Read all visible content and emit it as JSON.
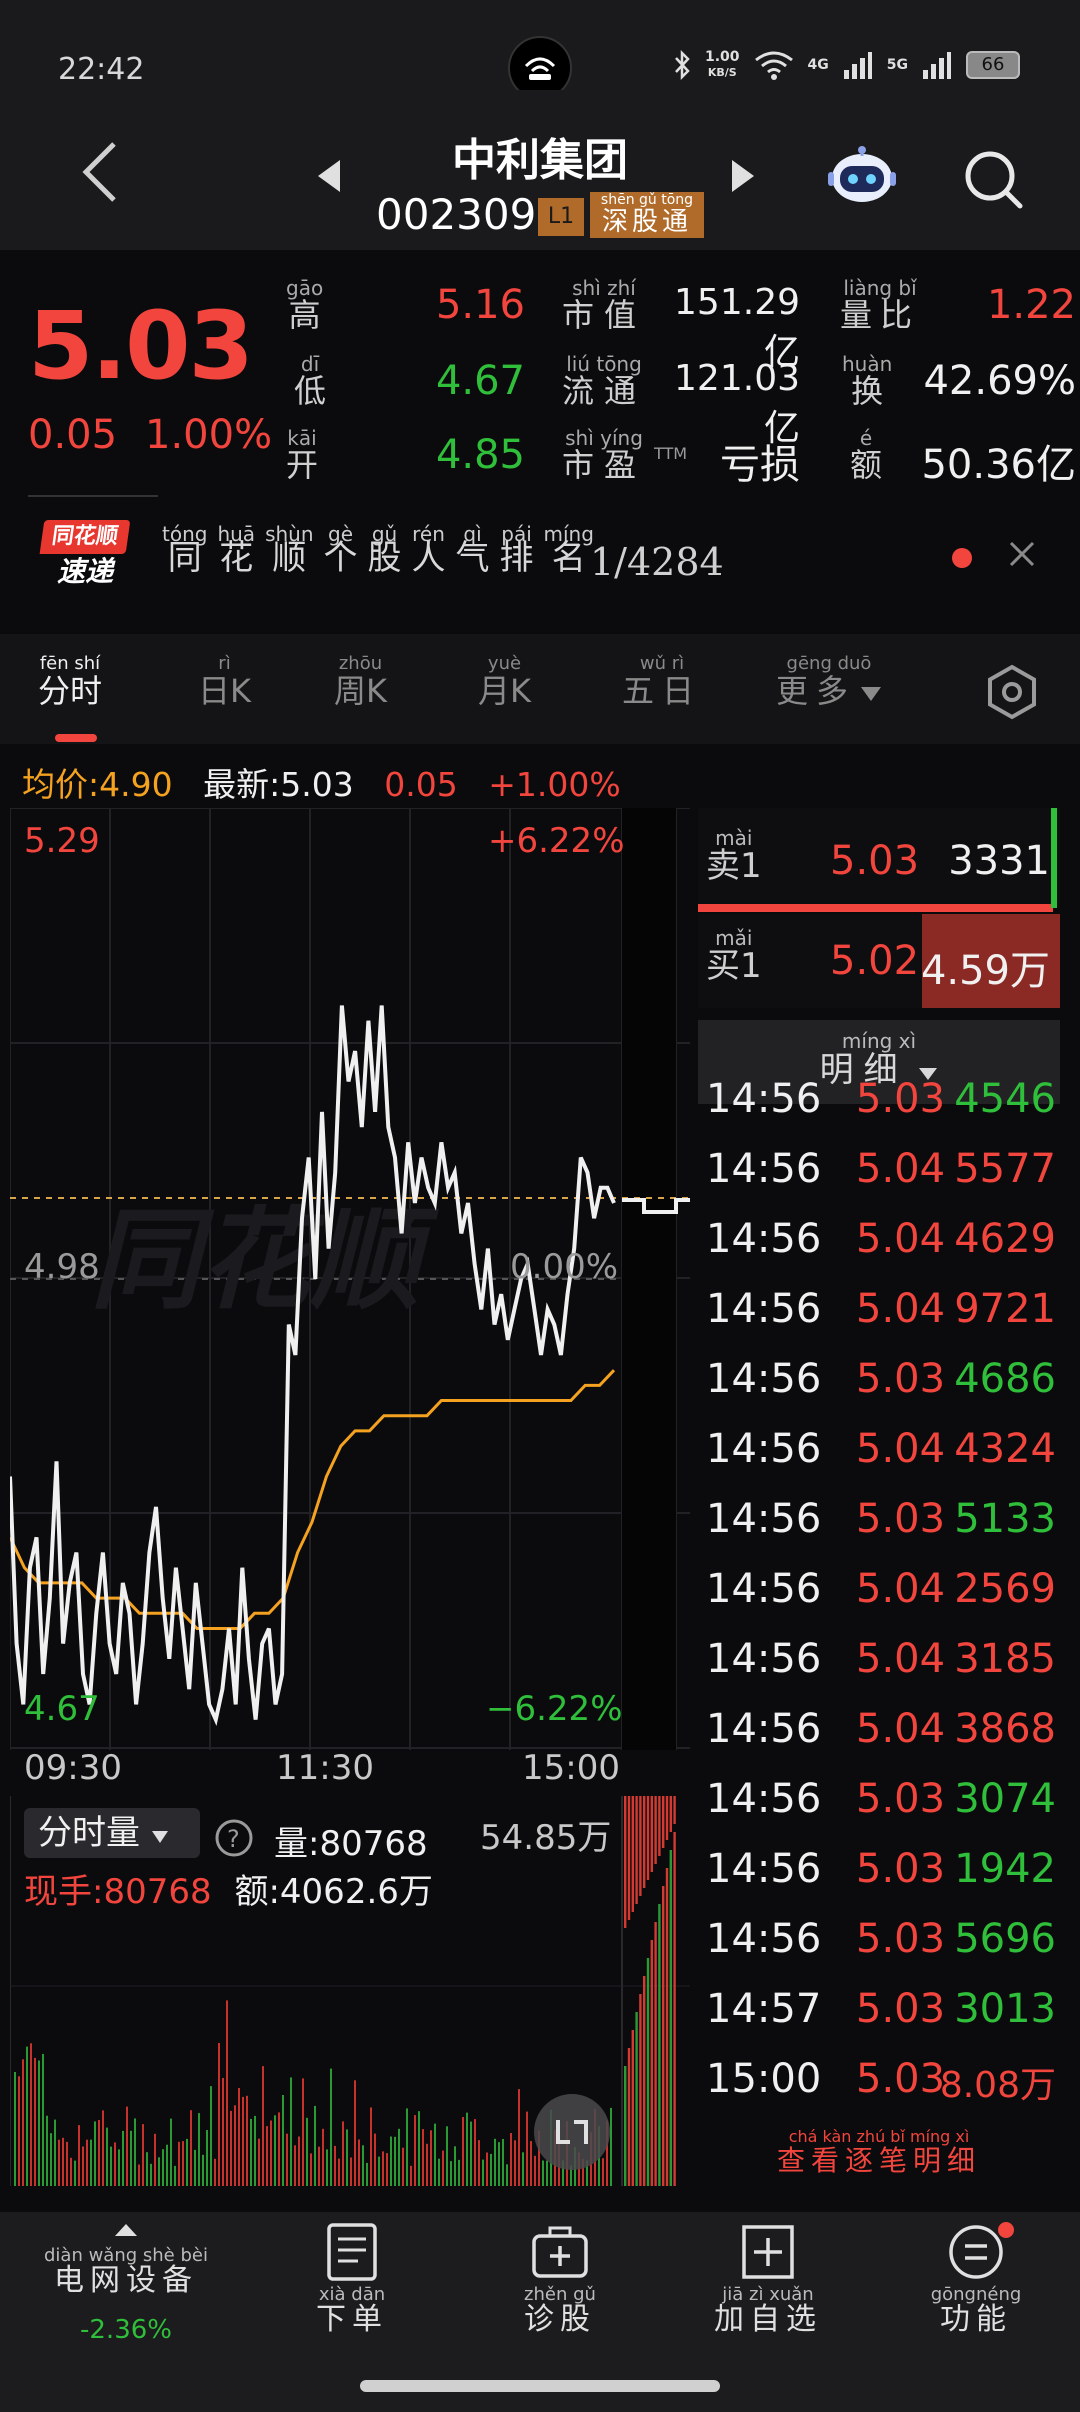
{
  "status_bar": {
    "time": "22:42",
    "net_speed_value": "1.00",
    "net_speed_unit": "KB/S",
    "signal1": "4G",
    "signal2": "5G",
    "battery": "66"
  },
  "header": {
    "stock_name": "中利集团",
    "stock_code": "002309",
    "level_badge": "L1",
    "connect_badge": {
      "py": "shēn gǔ tōng",
      "hz": "深股通"
    }
  },
  "quote": {
    "last_price": "5.03",
    "change_amount": "0.05",
    "change_percent": "1.00%",
    "fields": [
      {
        "py": "gāo",
        "hz": "高",
        "value": "5.16",
        "color": "#f2453d"
      },
      {
        "py": "dī",
        "hz": "低",
        "value": "4.67",
        "color": "#2fbf3a"
      },
      {
        "py": "kāi",
        "hz": "开",
        "value": "4.85",
        "color": "#2fbf3a"
      },
      {
        "py": "shì zhí",
        "hz": "市值",
        "value": "151.29亿",
        "color": "#f0f0f0"
      },
      {
        "py": "liú tōng",
        "hz": "流通",
        "value": "121.03亿",
        "color": "#f0f0f0"
      },
      {
        "py": "shì yíng",
        "hz": "市盈",
        "suffix": "TTM",
        "value": "亏损",
        "color": "#f0f0f0"
      },
      {
        "py": "liàng bǐ",
        "hz": "量比",
        "value": "1.22",
        "color": "#f2453d"
      },
      {
        "py": "huàn",
        "hz": "换",
        "value": "42.69%",
        "color": "#f0f0f0"
      },
      {
        "py": "é",
        "hz": "额",
        "value": "50.36亿",
        "color": "#f0f0f0"
      }
    ]
  },
  "rank_banner": {
    "logo_line1": "同花顺",
    "logo_line2": "速递",
    "text_py": [
      "tóng",
      "huā",
      "shùn",
      "gè",
      "gǔ",
      "rén",
      "qì",
      "pái",
      "míng"
    ],
    "text_hz": [
      "同",
      "花",
      "顺",
      "个",
      "股",
      "人",
      "气",
      "排",
      "名"
    ],
    "rank": "1/4284"
  },
  "tabs": [
    {
      "py": "fēn shí",
      "hz": "分时",
      "active": true
    },
    {
      "py": "rì",
      "hz": "日K"
    },
    {
      "py": "zhōu",
      "hz": "周K"
    },
    {
      "py": "yuè",
      "hz": "月K"
    },
    {
      "py": "wǔ rì",
      "hz": "五日"
    },
    {
      "py": "gēng duō",
      "hz": "更多"
    }
  ],
  "info_line": {
    "avg_label": "均价:",
    "avg_value": "4.90",
    "latest_label": "最新:",
    "latest_value": "5.03",
    "change": "0.05",
    "change_pct": "+1.00%"
  },
  "chart_data": {
    "type": "line",
    "title": "",
    "y_top": "5.29",
    "y_mid": "4.98",
    "y_bottom": "4.67",
    "pct_top": "+6.22%",
    "pct_mid": "0.00%",
    "pct_bottom": "−6.22%",
    "x_labels": [
      "09:30",
      "11:30",
      "15:00"
    ],
    "ylim": [
      4.67,
      5.29
    ],
    "prev_close": 4.98,
    "series": [
      {
        "values": [
          4.85,
          4.74,
          4.7,
          4.79,
          4.81,
          4.72,
          4.77,
          4.86,
          4.74,
          4.78,
          4.8,
          4.72,
          4.7,
          4.76,
          4.8,
          4.74,
          4.72,
          4.78,
          4.76,
          4.7,
          4.74,
          4.8,
          4.83,
          4.77,
          4.73,
          4.79,
          4.75,
          4.71,
          4.78,
          4.74,
          4.7,
          4.69,
          4.71,
          4.75,
          4.7,
          4.79,
          4.73,
          4.69,
          4.74,
          4.75,
          4.7,
          4.72,
          4.95,
          4.93,
          5.02,
          5.06,
          4.98,
          5.09,
          5.0,
          5.05,
          5.16,
          5.11,
          5.13,
          5.08,
          5.15,
          5.09,
          5.16,
          5.08,
          5.06,
          5.01,
          5.07,
          5.03,
          5.06,
          5.04,
          5.03,
          5.07,
          5.04,
          5.05,
          5.01,
          5.03,
          4.99,
          4.96,
          5.0,
          4.95,
          4.97,
          4.94,
          4.96,
          4.98,
          4.99,
          4.96,
          4.93,
          4.96,
          4.95,
          4.93,
          4.97,
          5.0,
          5.06,
          5.05,
          5.02,
          5.04,
          5.04,
          5.03
        ]
      },
      {
        "values": [
          4.81,
          4.79,
          4.78,
          4.78,
          4.78,
          4.78,
          4.77,
          4.77,
          4.77,
          4.76,
          4.76,
          4.76,
          4.76,
          4.75,
          4.75,
          4.75,
          4.75,
          4.76,
          4.76,
          4.77,
          4.8,
          4.82,
          4.85,
          4.87,
          4.88,
          4.88,
          4.89,
          4.89,
          4.89,
          4.89,
          4.9,
          4.9,
          4.9,
          4.9,
          4.9,
          4.9,
          4.9,
          4.9,
          4.9,
          4.9,
          4.91,
          4.91,
          4.92
        ]
      }
    ],
    "volume": {
      "title": "分时量",
      "vol_label": "量:",
      "vol_value": "80768",
      "hand_label": "现手:",
      "hand_value": "80768",
      "amount_label": "额:",
      "amount_value": "4062.6万",
      "max_label": "54.85万"
    }
  },
  "order_book": {
    "sell": {
      "py": "mài",
      "hz": "卖1",
      "price": "5.03",
      "volume": "3331"
    },
    "buy": {
      "py": "mǎi",
      "hz": "买1",
      "price": "5.02",
      "volume": "4.59万"
    },
    "detail_py": "míng xì",
    "detail_hz": "明细",
    "trades": [
      {
        "time": "14:56",
        "price": "5.03",
        "volume": "4546",
        "vol_color": "#2fbf3a"
      },
      {
        "time": "14:56",
        "price": "5.04",
        "volume": "5577",
        "vol_color": "#f2453d"
      },
      {
        "time": "14:56",
        "price": "5.04",
        "volume": "4629",
        "vol_color": "#f2453d"
      },
      {
        "time": "14:56",
        "price": "5.04",
        "volume": "9721",
        "vol_color": "#f2453d"
      },
      {
        "time": "14:56",
        "price": "5.03",
        "volume": "4686",
        "vol_color": "#2fbf3a"
      },
      {
        "time": "14:56",
        "price": "5.04",
        "volume": "4324",
        "vol_color": "#f2453d"
      },
      {
        "time": "14:56",
        "price": "5.03",
        "volume": "5133",
        "vol_color": "#2fbf3a"
      },
      {
        "time": "14:56",
        "price": "5.04",
        "volume": "2569",
        "vol_color": "#f2453d"
      },
      {
        "time": "14:56",
        "price": "5.04",
        "volume": "3185",
        "vol_color": "#f2453d"
      },
      {
        "time": "14:56",
        "price": "5.04",
        "volume": "3868",
        "vol_color": "#f2453d"
      },
      {
        "time": "14:56",
        "price": "5.03",
        "volume": "3074",
        "vol_color": "#2fbf3a"
      },
      {
        "time": "14:56",
        "price": "5.03",
        "volume": "1942",
        "vol_color": "#2fbf3a"
      },
      {
        "time": "14:56",
        "price": "5.03",
        "volume": "5696",
        "vol_color": "#2fbf3a"
      },
      {
        "time": "14:57",
        "price": "5.03",
        "volume": "3013",
        "vol_color": "#2fbf3a"
      },
      {
        "time": "15:00",
        "price": "5.03",
        "volume": "8.08万",
        "vol_color": "#f2453d"
      }
    ],
    "view_detail_py": "chá kàn zhú bǐ míng xì",
    "view_detail_hz": "查看逐笔明细"
  },
  "bottom_nav": [
    {
      "py": "diàn wǎng shè bèi",
      "hz": "电网设备",
      "sub": "-2.36%"
    },
    {
      "py": "xià dān",
      "hz": "下单"
    },
    {
      "py": "zhěn gǔ",
      "hz": "诊股"
    },
    {
      "py": "jiā zì xuǎn",
      "hz": "加自选"
    },
    {
      "py": "gōngnéng",
      "hz": "功能"
    }
  ],
  "colors": {
    "up": "#f2453d",
    "down": "#2fbf3a",
    "avg": "#f4a21f",
    "line": "#f0f0f0"
  }
}
